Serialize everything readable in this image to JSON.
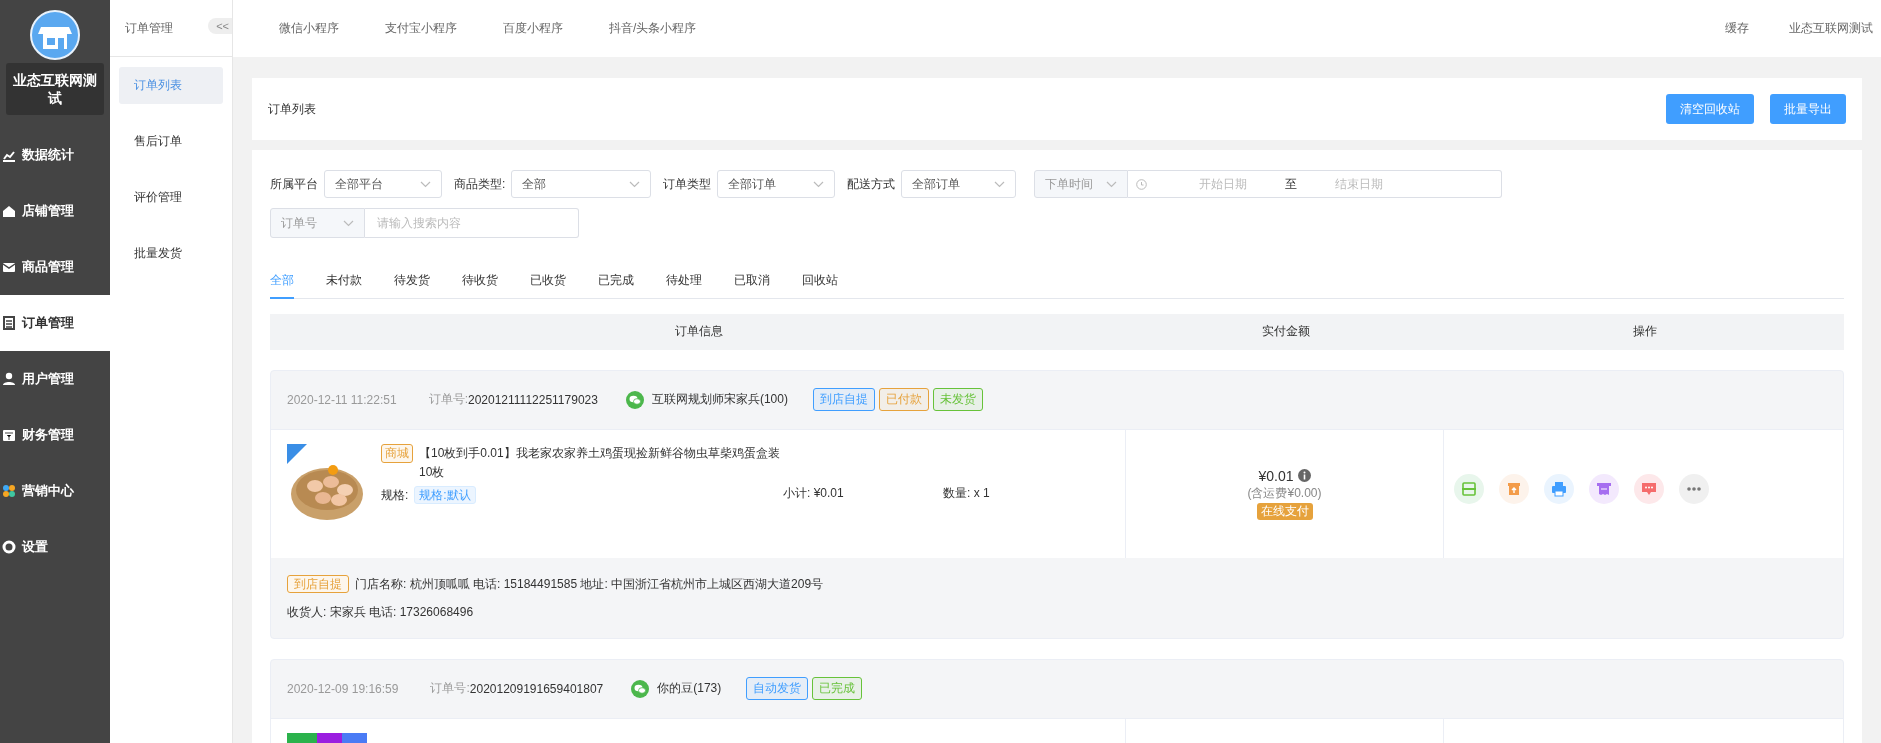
{
  "brand": {
    "name": "业态互联网测试"
  },
  "nav": [
    {
      "label": "数据统计",
      "selected": false
    },
    {
      "label": "店铺管理",
      "selected": false
    },
    {
      "label": "商品管理",
      "selected": false
    },
    {
      "label": "订单管理",
      "selected": true
    },
    {
      "label": "用户管理",
      "selected": false
    },
    {
      "label": "财务管理",
      "selected": false
    },
    {
      "label": "营销中心",
      "selected": false
    },
    {
      "label": "设置",
      "selected": false
    }
  ],
  "subnav": {
    "title": "订单管理",
    "collapse": "<<",
    "items": [
      {
        "label": "订单列表",
        "selected": true
      },
      {
        "label": "售后订单",
        "selected": false
      },
      {
        "label": "评价管理",
        "selected": false
      },
      {
        "label": "批量发货",
        "selected": false
      }
    ]
  },
  "top_tabs": [
    "微信小程序",
    "支付宝小程序",
    "百度小程序",
    "抖音/头条小程序"
  ],
  "top_right": {
    "cache": "缓存",
    "user": "业态互联网测试"
  },
  "page_title": "订单列表",
  "buttons": [
    "清空回收站",
    "批量导出"
  ],
  "filters": [
    {
      "label": "所属平台",
      "value": "全部平台"
    },
    {
      "label": "商品类型:",
      "value": "全部"
    },
    {
      "label": "订单类型",
      "value": "全部订单"
    },
    {
      "label": "配送方式",
      "value": "全部订单"
    }
  ],
  "date_filter": {
    "type": "下单时间",
    "start_placeholder": "开始日期",
    "separator": "至",
    "end_placeholder": "结束日期"
  },
  "search": {
    "field": "订单号",
    "placeholder": "请输入搜索内容"
  },
  "status_tabs": [
    {
      "label": "全部",
      "selected": true
    },
    {
      "label": "未付款",
      "selected": false
    },
    {
      "label": "待发货",
      "selected": false
    },
    {
      "label": "待收货",
      "selected": false
    },
    {
      "label": "已收货",
      "selected": false
    },
    {
      "label": "已完成",
      "selected": false
    },
    {
      "label": "待处理",
      "selected": false
    },
    {
      "label": "已取消",
      "selected": false
    },
    {
      "label": "回收站",
      "selected": false
    }
  ],
  "table": {
    "columns": [
      "订单信息",
      "实付金额",
      "操作"
    ]
  },
  "orders": [
    {
      "time": "2020-12-11 11:22:51",
      "order_no_label": "订单号:",
      "order_no": "20201211112251179023",
      "buyer": "互联网规划师宋家兵(100)",
      "tags": [
        {
          "label": "到店自提",
          "color": "#409eff"
        },
        {
          "label": "已付款",
          "color": "#e6a23c"
        },
        {
          "label": "未发货",
          "color": "#67c23a"
        }
      ],
      "product": {
        "source": "商城",
        "title": "【10枚到手0.01】我老家农家养土鸡蛋现捡新鲜谷物虫草柴鸡蛋盒装10枚",
        "spec_label": "规格:",
        "spec": "规格:默认",
        "subtotal": "小计:  ¥0.01",
        "quantity": "数量:  x 1"
      },
      "amount": "¥0.01",
      "shipping": "(含运费¥0.00)",
      "pay_method": "在线支付",
      "delivery_tag": "到店自提",
      "store_info": "门店名称: 杭州顶呱呱 电话: 15184491585 地址: 中国浙江省杭州市上城区西湖大道209号",
      "receiver": "收货人: 宋家兵 电话: 17326068496"
    },
    {
      "time": "2020-12-09 19:16:59",
      "order_no_label": "订单号:",
      "order_no": "20201209191659401807",
      "buyer": "你的豆(173)",
      "tags": [
        {
          "label": "自动发货",
          "color": "#409eff"
        },
        {
          "label": "已完成",
          "color": "#67c23a"
        }
      ]
    }
  ]
}
